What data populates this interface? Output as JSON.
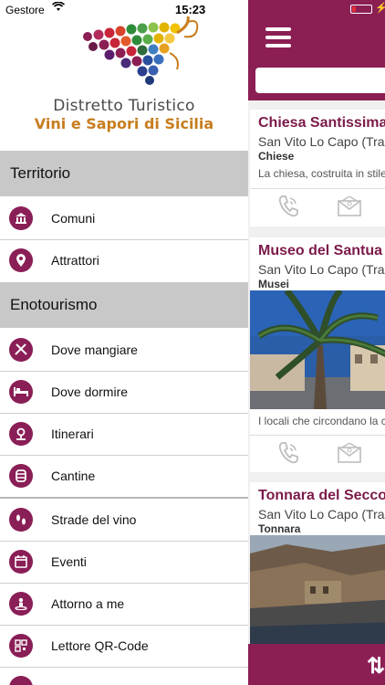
{
  "status_bar": {
    "carrier": "Gestore",
    "time": "15:23"
  },
  "logo": {
    "title": "Distretto Turistico",
    "subtitle": "Vini e Sapori di Sicilia"
  },
  "sections": [
    {
      "label": "Territorio",
      "items": [
        {
          "label": "Comuni",
          "icon": "building-icon"
        },
        {
          "label": "Attrattori",
          "icon": "map-pin-icon"
        }
      ]
    },
    {
      "label": "Enotourismo",
      "items": [
        {
          "label": "Dove mangiare",
          "icon": "cutlery-icon"
        },
        {
          "label": "Dove dormire",
          "icon": "bed-icon"
        },
        {
          "label": "Itinerari",
          "icon": "route-icon"
        },
        {
          "label": "Cantine",
          "icon": "barrel-icon"
        }
      ]
    }
  ],
  "extra_items": [
    {
      "label": "Strade del vino",
      "icon": "footsteps-icon"
    },
    {
      "label": "Eventi",
      "icon": "calendar-icon"
    },
    {
      "label": "Attorno a me",
      "icon": "person-location-icon"
    },
    {
      "label": "Lettore QR-Code",
      "icon": "qr-code-icon"
    }
  ],
  "cards": [
    {
      "title": "Chiesa Santissima",
      "location": "San Vito Lo Capo (Tra",
      "category": "Chiese",
      "description": "La chiesa, costruita in stile"
    },
    {
      "title": "Museo del Santua",
      "location": "San Vito Lo Capo (Tra",
      "category": "Musei",
      "description": "I locali che circondano la c"
    },
    {
      "title": "Tonnara del Secco",
      "location": "San Vito Lo Capo (Tra",
      "category": "Tonnara"
    }
  ],
  "colors": {
    "brand": "#8b1f54",
    "section_bg": "#c8c8c8",
    "logo_accent": "#c87d1e"
  }
}
